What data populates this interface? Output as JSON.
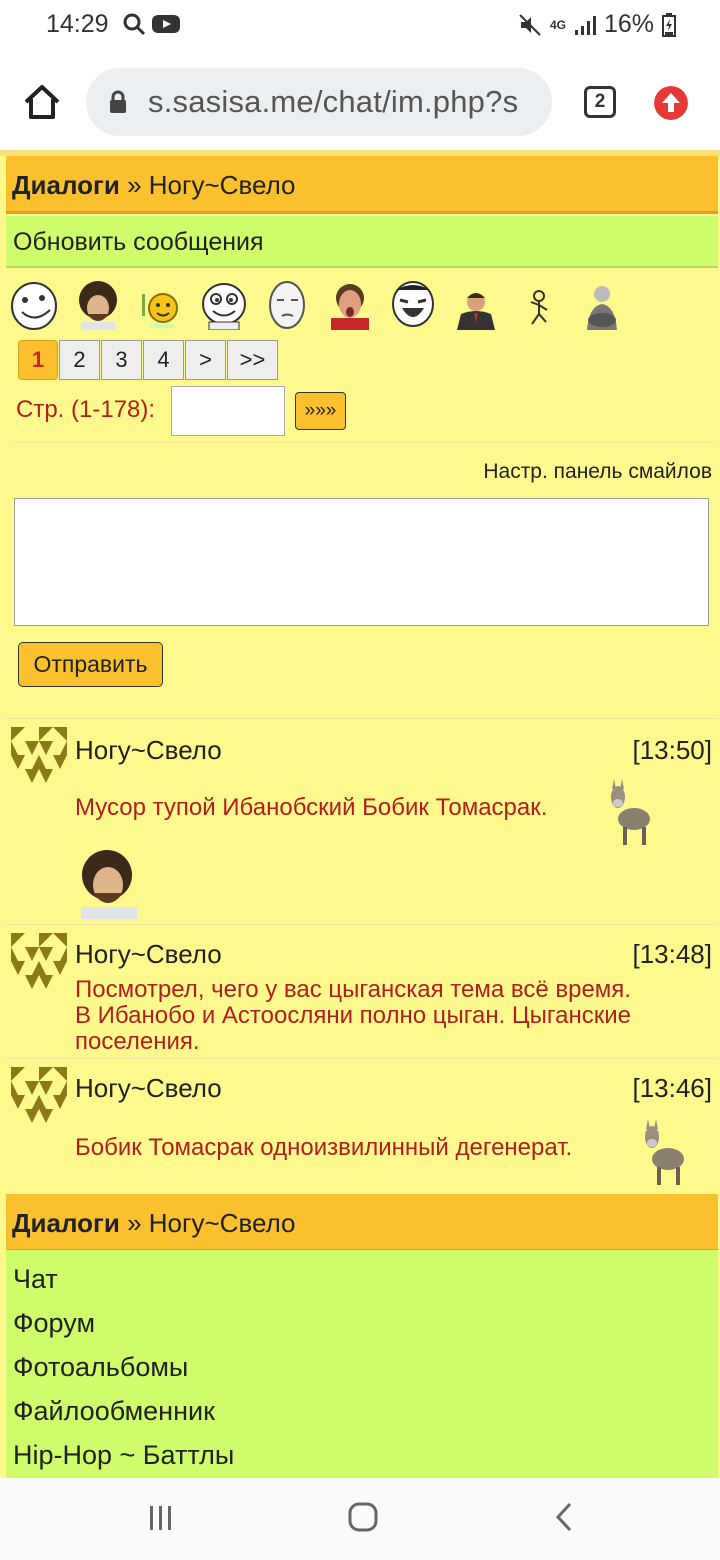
{
  "status_bar": {
    "time": "14:29",
    "battery_percent": "16%",
    "network_label": "4G"
  },
  "browser": {
    "url": "s.sasisa.me/chat/im.php?s",
    "tab_count": "2"
  },
  "header": {
    "section": "Диалоги",
    "separator": "»",
    "user": "Ногу~Свело"
  },
  "refresh_label": "Обновить сообщения",
  "smiley_panel": {
    "icons": [
      "troll-face-icon",
      "bob-ross-icon",
      "yellow-smiley-icon",
      "derp-face-icon",
      "meme-face-icon",
      "shocked-man-icon",
      "laughing-meme-icon",
      "mr-bean-icon",
      "dancing-stickman-icon",
      "old-man-icon"
    ]
  },
  "pager": {
    "pages": [
      "1",
      "2",
      "3",
      "4",
      ">",
      ">>"
    ],
    "active": "1",
    "goto_label": "Стр. (1-178):",
    "goto_button": "»»»"
  },
  "smiley_settings_label": "Настр. панель смайлов",
  "compose": {
    "value": "",
    "send_label": "Отправить"
  },
  "messages": [
    {
      "author": "Ногу~Свело",
      "time": "[13:50]",
      "text": "Мусор тупой Ибанобский Бобик Томасрак."
    },
    {
      "author": "Ногу~Свело",
      "time": "[13:48]",
      "text_lines": [
        "Посмотрел, чего у вас цыганская тема всё время.",
        "В Ибанобо и Астоосляни полно цыган. Цыганские",
        "поселения."
      ]
    },
    {
      "author": "Ногу~Свело",
      "time": "[13:46]",
      "text": "Бобик Томасрак одноизвилинный дегенерат."
    }
  ],
  "footer_header": {
    "section": "Диалоги",
    "separator": "»",
    "user": "Ногу~Свело"
  },
  "nav_links": [
    "Чат",
    "Форум",
    "Фотоальбомы",
    "Файлообменник",
    "Hip-Hop ~ Баттлы"
  ],
  "colors": {
    "page_bg": "#fef98d",
    "header_bg": "#fbc02d",
    "green_bar": "#cefc6a",
    "message_text": "#b02020"
  }
}
